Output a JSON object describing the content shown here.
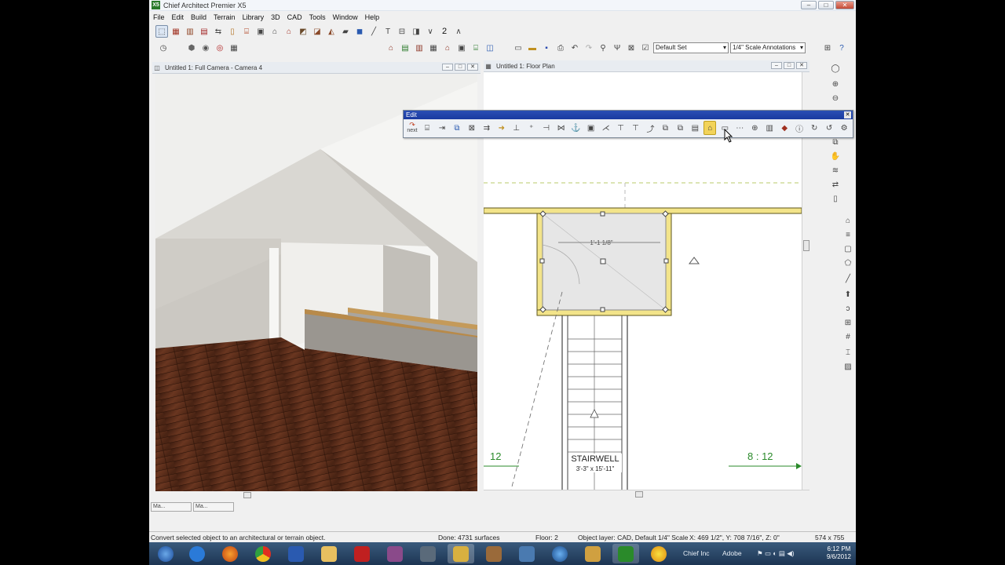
{
  "window": {
    "title": "Chief Architect Premier X5",
    "icon_label": "X5"
  },
  "menu": [
    "File",
    "Edit",
    "Build",
    "Terrain",
    "Library",
    "3D",
    "CAD",
    "Tools",
    "Window",
    "Help"
  ],
  "toolbar": {
    "layer_set": "Default Set",
    "annotation_set": "1/4\" Scale Annotations",
    "page_number": "2"
  },
  "camera_view": {
    "title": "Untitled 1: Full Camera - Camera 4"
  },
  "plan_view": {
    "title": "Untitled 1: Floor Plan",
    "dimension": "1'-1 1/8\"",
    "stairwell_label": "STAIRWELL",
    "stairwell_size": "3'-3\" x 15'-11\"",
    "pitch_left": "12",
    "pitch_right": "8 : 12"
  },
  "edit_palette": {
    "title": "Edit",
    "next_label": "next"
  },
  "tabs": [
    "Ma...",
    "Ma..."
  ],
  "status": {
    "hint": "Convert selected object to an architectural or terrain object.",
    "progress": "Done: 4731 surfaces",
    "floor": "Floor: 2",
    "object_layer": "Object layer: CAD,  Default 1/4\" Scale",
    "coords": "X: 469 1/2\", Y: 708 7/16\", Z: 0\"",
    "size": "574 x 755"
  },
  "taskbar": {
    "items": [
      "Chief Inc",
      "Adobe"
    ],
    "time": "6:12 PM",
    "date": "9/6/2012"
  },
  "colors": {
    "wall_fill": "#f3e48a",
    "wall_stroke": "#8a7a1a",
    "floor_wood": "#5a2e1a",
    "taskbar": "#2a4566"
  }
}
